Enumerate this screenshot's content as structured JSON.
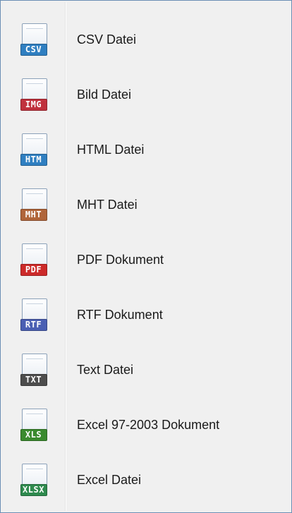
{
  "menu": {
    "items": [
      {
        "label": "CSV Datei",
        "tag": "CSV",
        "color": "#2f7fc1",
        "icon": "csv-file-icon"
      },
      {
        "label": "Bild Datei",
        "tag": "IMG",
        "color": "#c0313d",
        "icon": "image-file-icon"
      },
      {
        "label": "HTML Datei",
        "tag": "HTM",
        "color": "#2f7fc1",
        "icon": "html-file-icon"
      },
      {
        "label": "MHT Datei",
        "tag": "MHT",
        "color": "#b0653a",
        "icon": "mht-file-icon"
      },
      {
        "label": "PDF Dokument",
        "tag": "PDF",
        "color": "#cc2a2a",
        "icon": "pdf-file-icon"
      },
      {
        "label": "RTF Dokument",
        "tag": "RTF",
        "color": "#4a5fb3",
        "icon": "rtf-file-icon"
      },
      {
        "label": "Text Datei",
        "tag": "TXT",
        "color": "#4d4d4d",
        "icon": "txt-file-icon"
      },
      {
        "label": "Excel 97-2003 Dokument",
        "tag": "XLS",
        "color": "#3a8a2e",
        "icon": "xls-file-icon"
      },
      {
        "label": "Excel Datei",
        "tag": "XLSX",
        "color": "#2e8a4e",
        "icon": "xlsx-file-icon"
      }
    ]
  }
}
